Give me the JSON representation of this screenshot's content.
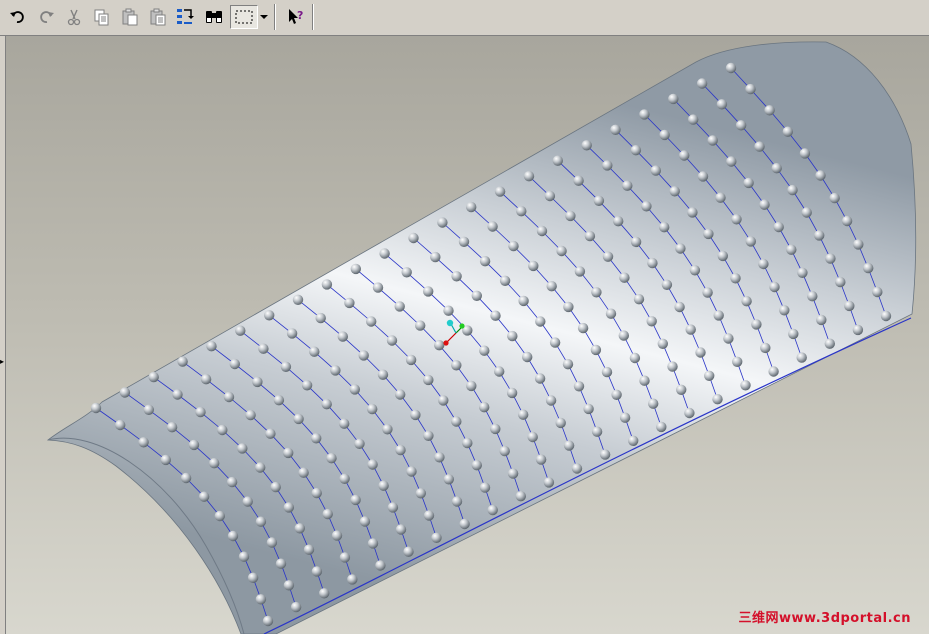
{
  "toolbar": {
    "buttons": [
      {
        "name": "undo",
        "icon": "undo-icon"
      },
      {
        "name": "redo",
        "icon": "redo-icon"
      },
      {
        "name": "cut",
        "icon": "scissors-icon"
      },
      {
        "name": "copy",
        "icon": "copy-icon"
      },
      {
        "name": "paste",
        "icon": "paste-icon"
      },
      {
        "name": "paste-special",
        "icon": "paste-special-icon"
      },
      {
        "name": "regenerate",
        "icon": "regenerate-icon"
      },
      {
        "name": "find",
        "icon": "binoculars-icon"
      },
      {
        "name": "selection-box",
        "icon": "dashed-box-icon"
      },
      {
        "name": "context-help",
        "icon": "arrow-question-icon"
      }
    ]
  },
  "viewport": {
    "model": "cylindrical-surface-with-sphere-pattern",
    "colors": {
      "surface": "#c9ced3",
      "sphere": "#b9bec3",
      "curve": "#2a35c8",
      "background": "#bdbbb1"
    }
  },
  "watermark": {
    "text": "三维网www.3dportal.cn",
    "color": "#d4102a"
  }
}
